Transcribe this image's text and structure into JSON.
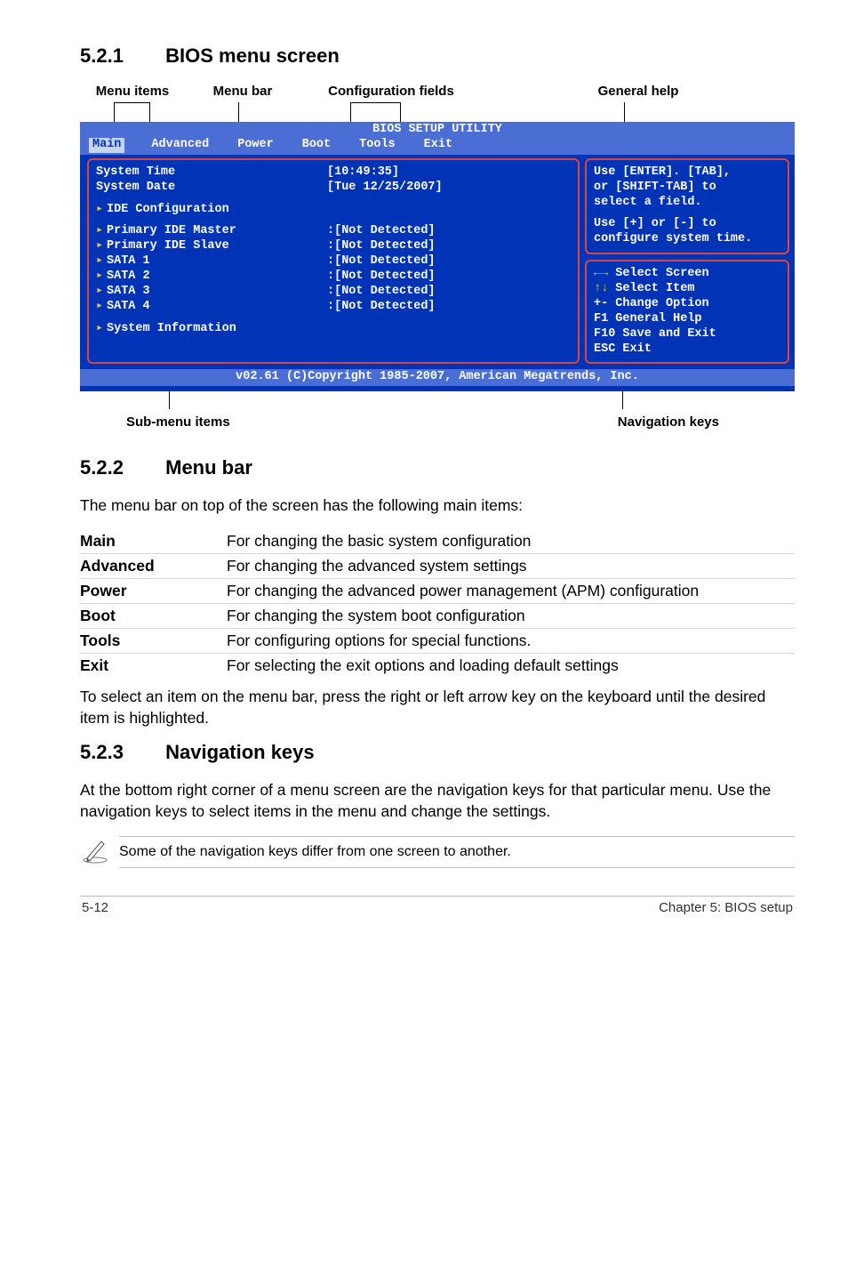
{
  "sections": {
    "s521": {
      "num": "5.2.1",
      "title": "BIOS menu screen"
    },
    "s522": {
      "num": "5.2.2",
      "title": "Menu bar"
    },
    "s523": {
      "num": "5.2.3",
      "title": "Navigation keys"
    }
  },
  "diag_labels": {
    "menu_items": "Menu items",
    "menu_bar": "Menu bar",
    "config_fields": "Configuration fields",
    "general_help": "General help",
    "submenu_items": "Sub-menu items",
    "nav_keys": "Navigation keys"
  },
  "bios": {
    "title": "BIOS SETUP UTILITY",
    "menu": {
      "main": "Main",
      "advanced": "Advanced",
      "power": "Power",
      "boot": "Boot",
      "tools": "Tools",
      "exit": "Exit"
    },
    "left": {
      "sys_time_k": "System Time",
      "sys_time_v": "[10:49:35]",
      "sys_date_k": "System Date",
      "sys_date_v": "[Tue 12/25/2007]",
      "ide_cfg": "IDE Configuration",
      "pim_k": "Primary IDE Master",
      "pis_k": "Primary IDE Slave",
      "sata1": "SATA 1",
      "sata2": "SATA 2",
      "sata3": "SATA 3",
      "sata4": "SATA 4",
      "nd": ":[Not Detected]",
      "sysinfo": "System Information"
    },
    "right_top": {
      "l1": "Use [ENTER]. [TAB],",
      "l2": "or [SHIFT-TAB] to",
      "l3": "select a field.",
      "l4": "Use [+] or [-] to",
      "l5": "configure system time."
    },
    "right_bot": {
      "sel_screen": " Select Screen",
      "sel_item": "   Select Item",
      "change": "+-  Change Option",
      "help": "F1  General Help",
      "save": "F10 Save and Exit",
      "esc": "ESC Exit"
    },
    "footer": "v02.61 (C)Copyright 1985-2007, American Megatrends, Inc."
  },
  "s522_intro": "The menu bar on top of the screen has the following main items:",
  "defs": {
    "main_k": "Main",
    "main_v": "For changing the basic system configuration",
    "adv_k": "Advanced",
    "adv_v": "For changing the advanced system settings",
    "pwr_k": "Power",
    "pwr_v": "For changing the advanced power management (APM) configuration",
    "boot_k": "Boot",
    "boot_v": "For changing the system boot configuration",
    "tools_k": "Tools",
    "tools_v": "For configuring options for special functions.",
    "exit_k": "Exit",
    "exit_v": "For selecting the exit options and loading default settings"
  },
  "s522_out": "To select an item on the menu bar, press the right or left arrow key on the keyboard until the desired item is highlighted.",
  "s523_body": "At the bottom right corner of a menu screen are the navigation keys for that particular menu. Use the navigation keys to select items in the menu and change the settings.",
  "note": "Some of the navigation keys differ from one screen to another.",
  "footer": {
    "left": "5-12",
    "right": "Chapter 5: BIOS setup"
  }
}
